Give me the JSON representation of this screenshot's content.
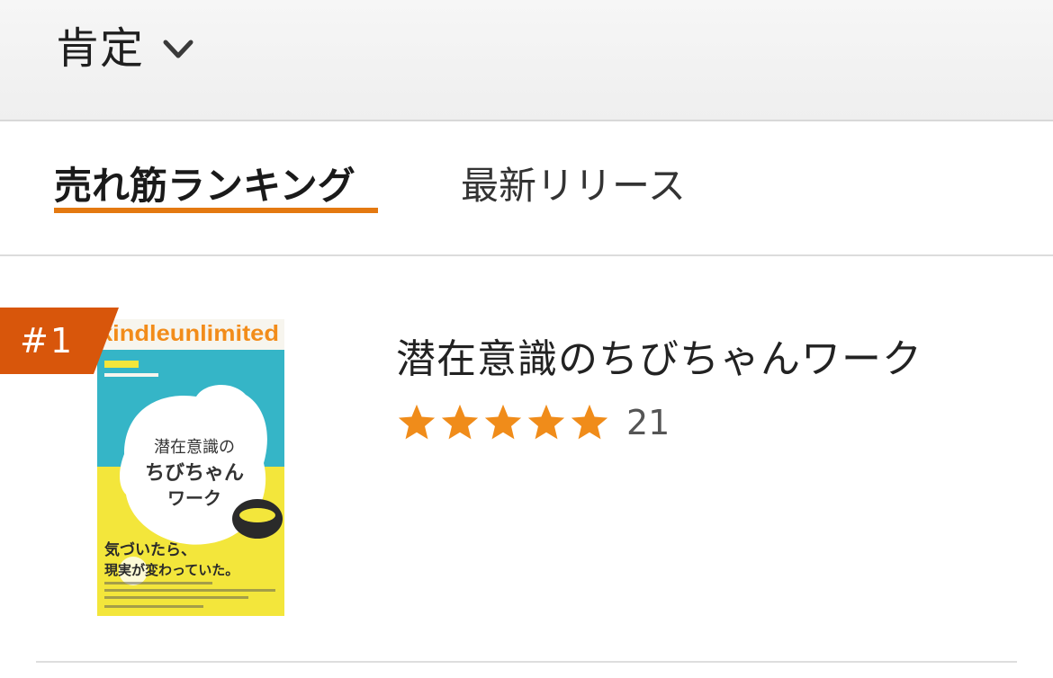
{
  "filter": {
    "label": "肯定",
    "dropdown_icon": "chevron-down-icon"
  },
  "tabs": [
    {
      "label": "売れ筋ランキング",
      "active": true
    },
    {
      "label": "最新リリース",
      "active": false
    }
  ],
  "colors": {
    "accent": "#e47911",
    "rank_badge": "#d8560b",
    "star": "#f08c1a",
    "cover_top": "#35b5c7",
    "cover_bottom": "#f3e63b"
  },
  "items": [
    {
      "rank": "#1",
      "title": "潜在意識のちびちゃんワーク",
      "rating_stars": 5,
      "review_count": "21",
      "cover": {
        "banner": "kindleunlimited",
        "title_lines": [
          "潜在意識の",
          "ちびちゃん",
          "ワーク"
        ],
        "tagline_lines": [
          "気づいたら、",
          "現実が変わっていた。"
        ]
      }
    }
  ]
}
